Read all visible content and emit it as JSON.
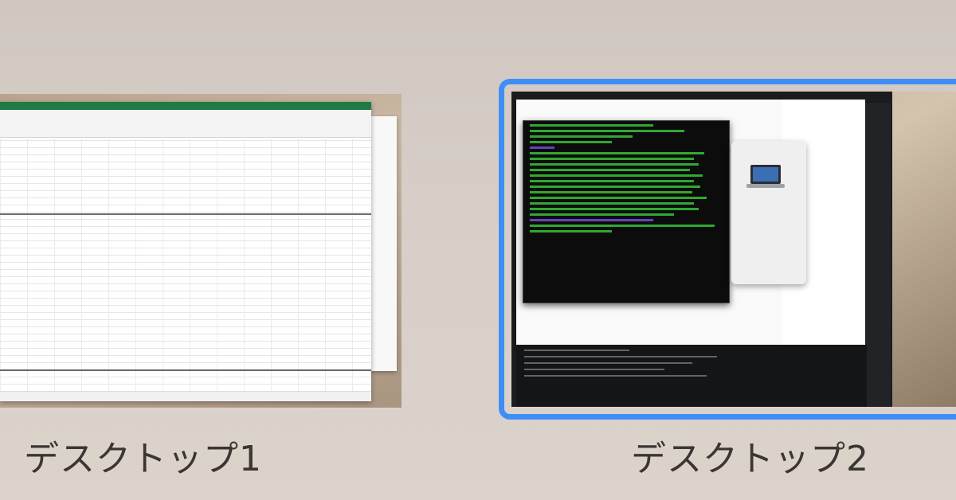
{
  "spaces": [
    {
      "label": "デスクトップ1",
      "selected": false
    },
    {
      "label": "デスクトップ2",
      "selected": true
    }
  ],
  "colors": {
    "selection_ring": "#3e8ef7",
    "excel_green": "#1f7a45",
    "terminal_green": "#37c43a"
  }
}
